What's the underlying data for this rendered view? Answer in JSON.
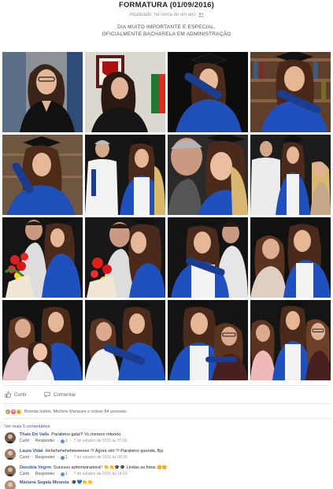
{
  "album": {
    "title": "FORMATURA (01/09/2016)",
    "updated": "Atualizado: há cerca de um ano",
    "description_line1": "DIA MUITO IMPORTANTE E ESPECIAL.",
    "description_line2": "OFICIALMENTE BACHARELA EM ADMINISTRAÇÃO"
  },
  "photos": [
    {
      "scene": "portrait-blazer",
      "bg": "#8a8f95"
    },
    {
      "scene": "portrait-diploma-room",
      "bg": "#3a2c24"
    },
    {
      "scene": "gown-diploma",
      "bg": "#111111"
    },
    {
      "scene": "gown-bookshelf",
      "bg": "#6b4a33"
    },
    {
      "scene": "gown-bookshelf-2",
      "bg": "#6e5640"
    },
    {
      "scene": "with-father",
      "bg": "#161616"
    },
    {
      "scene": "father-kiss",
      "bg": "#2a2a2a"
    },
    {
      "scene": "with-parents",
      "bg": "#1c1c1c"
    },
    {
      "scene": "with-partner-flowers",
      "bg": "#151515"
    },
    {
      "scene": "partner-kiss",
      "bg": "#181818"
    },
    {
      "scene": "with-partner",
      "bg": "#141414"
    },
    {
      "scene": "with-friend",
      "bg": "#111111"
    },
    {
      "scene": "with-mother-child",
      "bg": "#121212"
    },
    {
      "scene": "with-friend-diploma",
      "bg": "#161616"
    },
    {
      "scene": "with-friend-2",
      "bg": "#141414"
    },
    {
      "scene": "group-three",
      "bg": "#151515"
    }
  ],
  "actions": {
    "like_label": "Curtir",
    "comment_label": "Comentar"
  },
  "reactions": {
    "summary": "Brenda Isaimi, Michele Marques e outras 84 pessoas"
  },
  "more_comments": "Ver mais 5 comentários",
  "comments": [
    {
      "author": "Thaís Do Valle",
      "text": "Parabéns gata!!! Vc merece mtoooo",
      "like": "Curtir",
      "reply": "Responder",
      "likes": "1",
      "time": "7 de outubro de 2016 às 07:00",
      "avatar": "#6d5a4c"
    },
    {
      "author": "Laura Vidal",
      "text": "Hehehehehehéeeeeee !!! Agora sim !!! Parabéns querida. Bjs",
      "like": "Curtir",
      "reply": "Responder",
      "likes": "1",
      "time": "7 de outubro de 2016 às 09:30",
      "avatar": "#9a7b68"
    },
    {
      "author": "Denúbia Vegrm",
      "text": "Sucesso administradora!! 👏👏🎓🎓 Lindas as fotos 😊😊",
      "like": "Curtir",
      "reply": "Responder",
      "likes": "1",
      "time": "7 de outubro de 2016 às 14:19",
      "avatar": "#7e6a55"
    },
    {
      "author": "Mariana Segala Miranda",
      "text": "🎓💙👏👏",
      "avatar": "#b08d77"
    }
  ],
  "colors": {
    "link": "#385898",
    "like": "#5890ff",
    "love": "#f25268",
    "wow": "#f7b125"
  }
}
